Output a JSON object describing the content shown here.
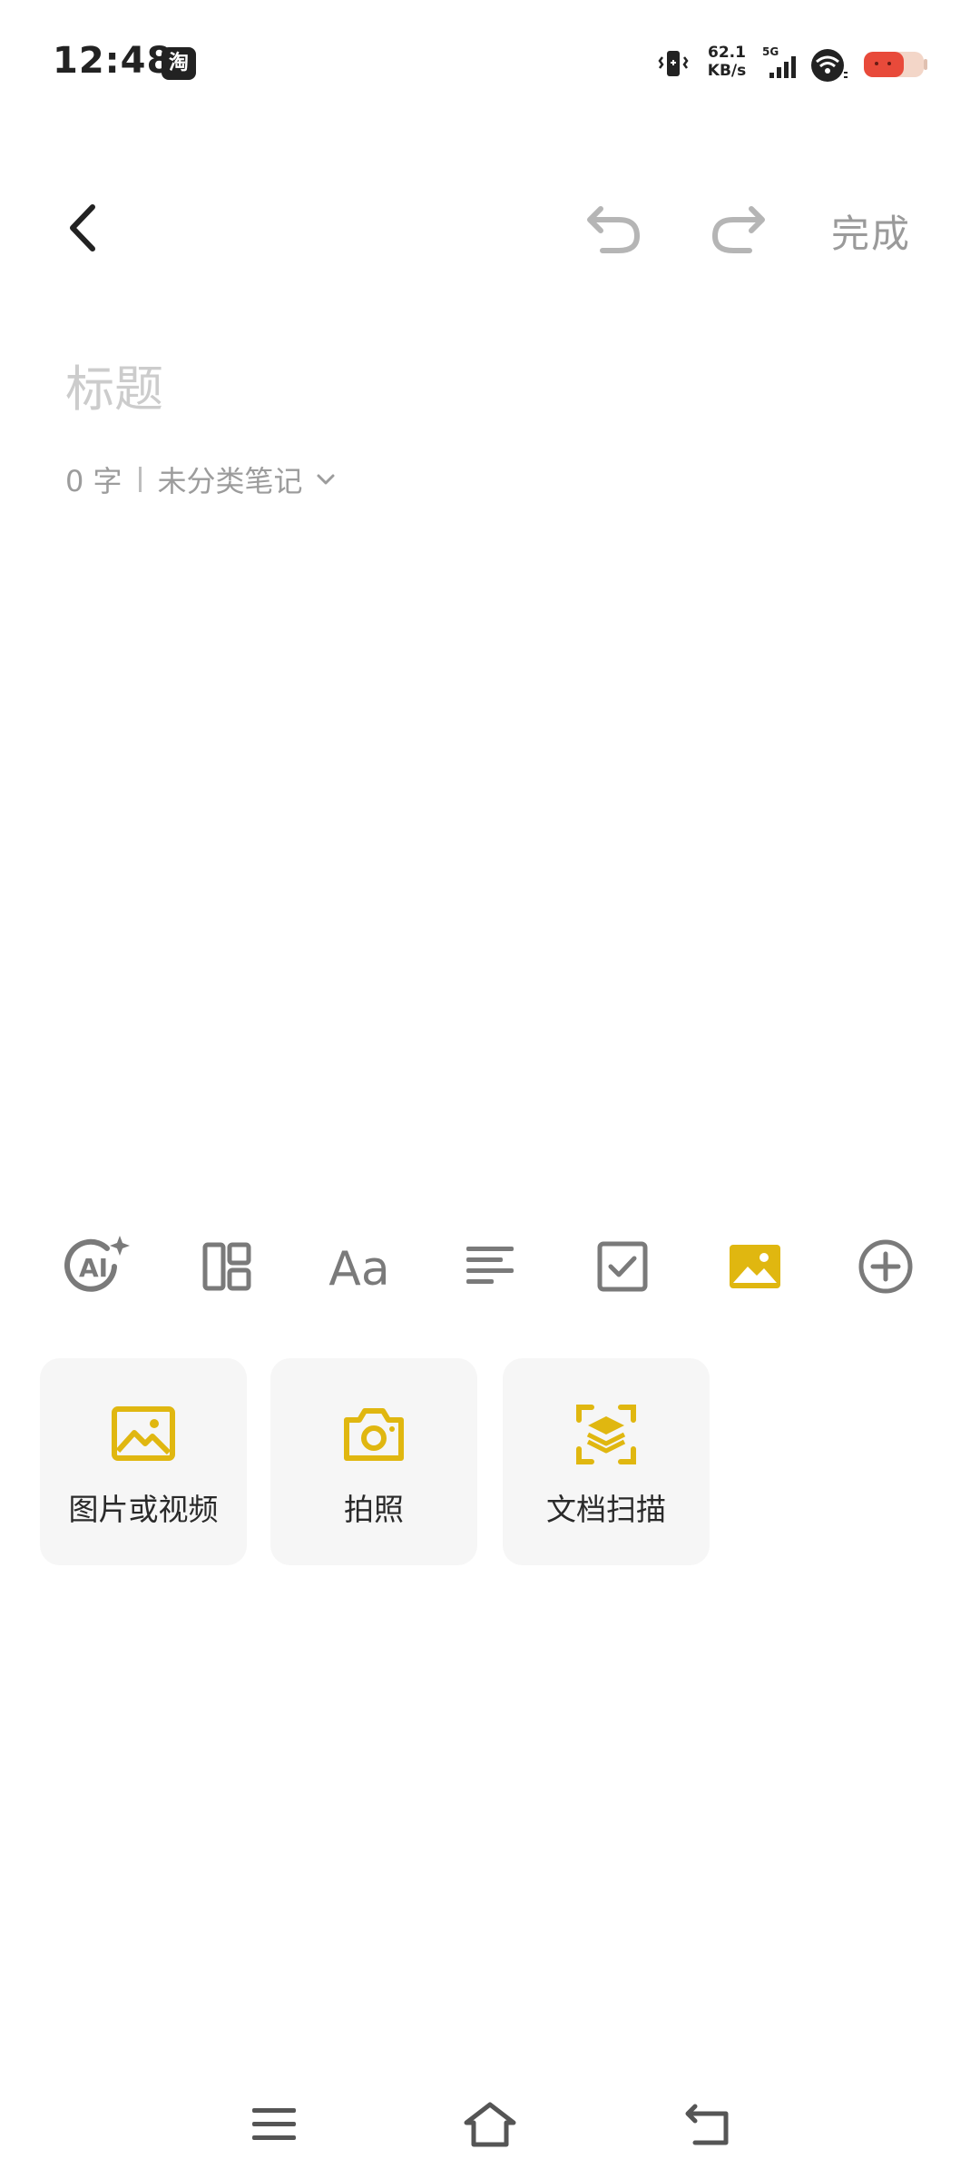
{
  "status_bar": {
    "time": "12:48",
    "app_badge": "淘",
    "net_speed_value": "62.1",
    "net_speed_unit": "KB/s",
    "network_type": "5G"
  },
  "header": {
    "done_label": "完成"
  },
  "note": {
    "title_placeholder": "标题",
    "word_count": "0 字",
    "category": "未分类笔记"
  },
  "toolbar": {
    "ai_label": "AI",
    "font_label": "Aa"
  },
  "media_options": [
    {
      "label": "图片或视频",
      "icon": "image-icon"
    },
    {
      "label": "拍照",
      "icon": "camera-icon"
    },
    {
      "label": "文档扫描",
      "icon": "scan-document-icon"
    }
  ],
  "colors": {
    "accent": "#E0B710",
    "icon_gray": "#7a7a7a",
    "disabled_gray": "#b5b5b5",
    "card_bg": "#f6f6f6"
  }
}
